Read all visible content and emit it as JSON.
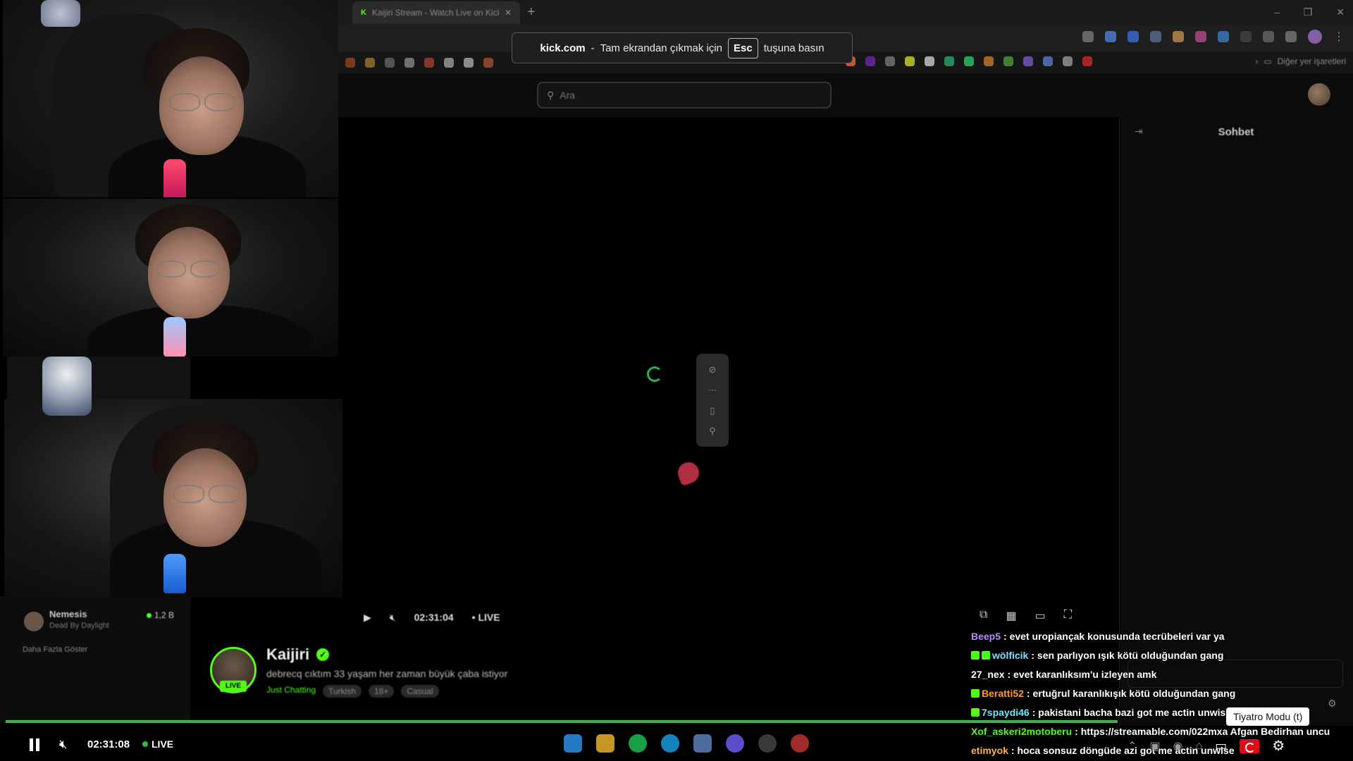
{
  "browser": {
    "tab_title": "Kaijiri Stream - Watch Live on Kick",
    "new_tab": "+",
    "win_min": "–",
    "win_max": "❐",
    "win_close": "✕",
    "bookmarks_more": "Diğer yer işaretleri"
  },
  "fullscreen_notice": {
    "host": "kick.com",
    "sep": "-",
    "before_key": "Tam ekrandan çıkmak için",
    "key": "Esc",
    "after_key": "tuşuna basın"
  },
  "kick": {
    "search_placeholder": "Ara",
    "chat_title": "Sohbet",
    "chat_collapse": "⇥"
  },
  "inner_player": {
    "time": "02:31:04",
    "live": "LIVE"
  },
  "streamer": {
    "name": "Kaijiri",
    "badge": "LIVE",
    "title": "debrecq cıktım 33 yaşam her zaman büyük çaba istiyor",
    "category": "Just Chatting",
    "tags": [
      "Turkish",
      "18+",
      "Casual"
    ]
  },
  "sidebar": {
    "rec_name": "Nemesis",
    "rec_game": "Dead By Daylight",
    "rec_viewers": "1,2 B",
    "show_more": "Daha Fazla Göster"
  },
  "outer_player": {
    "time": "02:31:08",
    "live": "LIVE",
    "theater_tooltip": "Tiyatro Modu (t)"
  },
  "chat": [
    {
      "user": "Beep5",
      "user_color": "#b78bff",
      "badges": 0,
      "text": ": evet uropiançak konusunda tecrübeleri var ya"
    },
    {
      "user": "wölficik",
      "user_color": "#7ee0ff",
      "badges": 2,
      "text": ": sen parlıyon ışık kötü olduğundan gang"
    },
    {
      "user": "27_nex",
      "user_color": "#ffffff",
      "badges": 0,
      "text": ": evet karanlıksım'u izleyen amk"
    },
    {
      "user": "Beratti52",
      "user_color": "#ff9b3b",
      "badges": 1,
      "text": ": ertuğrul karanlıkışık kötü olduğundan gang"
    },
    {
      "user": "7spaydi46",
      "user_color": "#6ee7ff",
      "badges": 1,
      "text": ": pakistani bacha bazi got me actin unwise"
    },
    {
      "user": "Xof_askeri2motoberu",
      "user_color": "#53fc18",
      "badges": 0,
      "text": ": https://streamable.com/022mxa Afgan Bedirhan uncu"
    },
    {
      "user": "etimyok",
      "user_color": "#ffb347",
      "badges": 0,
      "text": ": hoca sonsuz döngüde azi got me actin unwise"
    }
  ],
  "colors": {
    "kick_green": "#53fc18",
    "progress_green": "#39b54a",
    "flag_red": "#e30a17"
  }
}
